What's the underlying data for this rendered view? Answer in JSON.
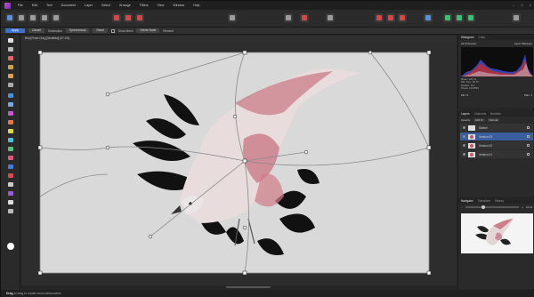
{
  "menu": [
    "File",
    "Edit",
    "Text",
    "Document",
    "Layer",
    "Select",
    "Arrange",
    "Filters",
    "View",
    "Window",
    "Help"
  ],
  "context_bar": {
    "apply": "Apply",
    "cancel": "Cancel",
    "destination_label": "Destination",
    "destination_value": "Synchronous",
    "reset": "Reset",
    "show_mesh": "Show Mesh",
    "delete_node": "Delete Node",
    "element": "Element"
  },
  "document": {
    "title": "Bird [Fixed Only] [Modified] (37.3%)"
  },
  "status": {
    "tool": "Drag",
    "hint": "to drag to create mesh deformation"
  },
  "histogram": {
    "tabs": [
      "Histogram",
      "Color"
    ],
    "channel": "All Channels",
    "layer_label": "Layer",
    "marquee_label": "Marquee",
    "stats": [
      "Mean: 120.41",
      "Std. Dev.: 56.72",
      "Median: 111",
      "Pixels: 1224583"
    ],
    "level_label": "Min:",
    "level_value": "0",
    "max_label": "Max:",
    "max_value": "1"
  },
  "layers": {
    "tabs": [
      "Layers",
      "Channels",
      "Brushes"
    ],
    "opacity_label": "Opacity:",
    "opacity_value": "100 %",
    "blend_mode": "Normal",
    "items": [
      {
        "name": "Sketch",
        "selected": false,
        "thumb": "plain"
      },
      {
        "name": "Version 03",
        "selected": true,
        "thumb": "pink"
      },
      {
        "name": "Version 02",
        "selected": false,
        "thumb": "pink"
      },
      {
        "name": "Version 01",
        "selected": false,
        "thumb": "pink"
      }
    ]
  },
  "navigator": {
    "tabs": [
      "Navigator",
      "Transform",
      "History"
    ],
    "zoom_value": "24 %"
  },
  "colors": {
    "accent": "#3d6fcc",
    "canvas_bg": "#d9d9d9",
    "bird_pink": "#c05a6a"
  }
}
